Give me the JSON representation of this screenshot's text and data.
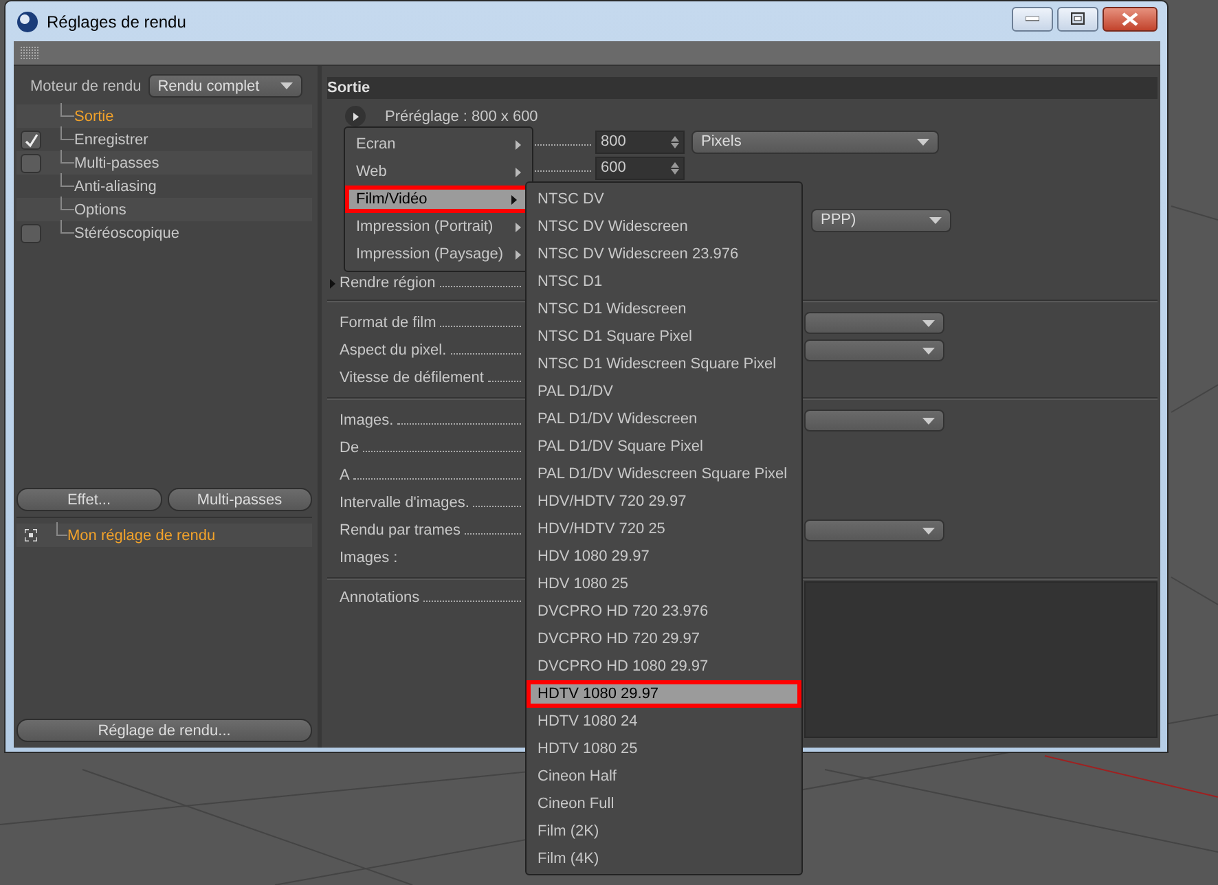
{
  "window": {
    "title": "Réglages de rendu"
  },
  "render_engine": {
    "label": "Moteur de rendu",
    "value": "Rendu complet"
  },
  "settings_tree": [
    {
      "label": "Sortie",
      "kind": "plain",
      "selected": true
    },
    {
      "label": "Enregistrer",
      "kind": "checkbox",
      "checked": true,
      "selected": false
    },
    {
      "label": "Multi-passes",
      "kind": "checkbox",
      "checked": false,
      "selected": false
    },
    {
      "label": "Anti-aliasing",
      "kind": "plain",
      "selected": false
    },
    {
      "label": "Options",
      "kind": "plain",
      "selected": false
    },
    {
      "label": "Stéréoscopique",
      "kind": "checkbox",
      "checked": false,
      "selected": false
    }
  ],
  "left_buttons": [
    "Effet...",
    "Multi-passes"
  ],
  "render_settings_list": [
    {
      "label": "Mon réglage de rendu",
      "active": true
    }
  ],
  "bottom_button": "Réglage de rendu...",
  "output": {
    "header": "Sortie",
    "preset": "Préréglage : 800 x 600",
    "size_fields": [
      {
        "value": "800",
        "unit": "Pixels"
      },
      {
        "value": "600"
      }
    ],
    "resolution_unit": "PPP)",
    "render_region": "Rendre région",
    "sections": [
      [
        {
          "label": "Format de film",
          "kind": "dropdown"
        },
        {
          "label": "Aspect du pixel.",
          "kind": "dropdown"
        },
        {
          "label": "Vitesse de défilement",
          "kind": "value"
        }
      ],
      [
        {
          "label": "Images.",
          "kind": "dropdown"
        },
        {
          "label": "De",
          "kind": "value"
        },
        {
          "label": "A",
          "kind": "value"
        },
        {
          "label": "Intervalle d'images.",
          "kind": "value"
        },
        {
          "label": "Rendu par trames",
          "kind": "dropdown"
        },
        {
          "label": "Images :",
          "kind": "caption"
        }
      ],
      [
        {
          "label": "Annotations",
          "kind": "textarea"
        }
      ]
    ]
  },
  "preset_menu": [
    {
      "label": "Ecran",
      "selected": false
    },
    {
      "label": "Web",
      "selected": false
    },
    {
      "label": "Film/Vidéo",
      "selected": true
    },
    {
      "label": "Impression (Portrait)",
      "selected": false
    },
    {
      "label": "Impression (Paysage)",
      "selected": false
    }
  ],
  "preset_submenu": [
    {
      "label": "NTSC DV",
      "selected": false
    },
    {
      "label": "NTSC DV Widescreen",
      "selected": false
    },
    {
      "label": "NTSC DV Widescreen 23.976",
      "selected": false
    },
    {
      "label": "NTSC D1",
      "selected": false
    },
    {
      "label": "NTSC D1 Widescreen",
      "selected": false
    },
    {
      "label": "NTSC D1 Square Pixel",
      "selected": false
    },
    {
      "label": "NTSC D1 Widescreen Square Pixel",
      "selected": false
    },
    {
      "label": "PAL D1/DV",
      "selected": false
    },
    {
      "label": "PAL D1/DV Widescreen",
      "selected": false
    },
    {
      "label": "PAL D1/DV Square Pixel",
      "selected": false
    },
    {
      "label": "PAL D1/DV Widescreen Square Pixel",
      "selected": false
    },
    {
      "label": "HDV/HDTV 720 29.97",
      "selected": false
    },
    {
      "label": "HDV/HDTV 720 25",
      "selected": false
    },
    {
      "label": "HDV 1080 29.97",
      "selected": false
    },
    {
      "label": "HDV 1080 25",
      "selected": false
    },
    {
      "label": "DVCPRO HD 720 23.976",
      "selected": false
    },
    {
      "label": "DVCPRO HD 720 29.97",
      "selected": false
    },
    {
      "label": "DVCPRO HD 1080 29.97",
      "selected": false
    },
    {
      "label": "HDTV 1080 29.97",
      "selected": true
    },
    {
      "label": "HDTV 1080 24",
      "selected": false
    },
    {
      "label": "HDTV 1080 25",
      "selected": false
    },
    {
      "label": "Cineon Half",
      "selected": false
    },
    {
      "label": "Cineon Full",
      "selected": false
    },
    {
      "label": "Film (2K)",
      "selected": false
    },
    {
      "label": "Film (4K)",
      "selected": false
    }
  ]
}
